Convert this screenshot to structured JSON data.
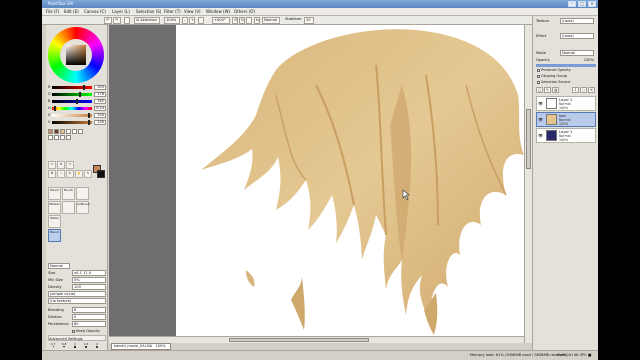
{
  "app": {
    "title": "PaintTool SAI"
  },
  "menu": [
    "File (F)",
    "Edit (E)",
    "Canvas (C)",
    "Layer (L)",
    "Selection (S)",
    "Filter (T)",
    "View (V)",
    "Window (W)",
    "Others (O)"
  ],
  "toolbar": {
    "selection_label": "Selection",
    "zoom": "100%",
    "rotation": "+000°",
    "mode": "Normal",
    "stabilizer_label": "Stabilizer",
    "stabilizer": "10"
  },
  "color_sliders": [
    {
      "label": "R",
      "value": "203"
    },
    {
      "label": "G",
      "value": "176"
    },
    {
      "label": "B",
      "value": "162"
    },
    {
      "label": "H",
      "value": "0.24"
    },
    {
      "label": "S",
      "value": "100"
    },
    {
      "label": "V",
      "value": "100"
    }
  ],
  "brushes": {
    "row1": [
      "Pencil",
      "Brush",
      ""
    ],
    "row2": [
      "Marker",
      "",
      "AirBrush"
    ],
    "row3": [
      "Water",
      "",
      ""
    ],
    "row4": [
      "Blend",
      "",
      ""
    ]
  },
  "brush_props": {
    "blend_mode": "Normal",
    "size_label": "Size",
    "size_value": "x0.1    17.0",
    "min_size_label": "Min Size",
    "min_size_value": "0%",
    "density_label": "Density",
    "density_value": "100",
    "shape_label": "(simple circle)",
    "texture_label": "(no texture)",
    "blending_label": "Blending",
    "blending_value": "8",
    "dilution_label": "Dilution",
    "dilution_value": "0",
    "persistence_label": "Persistence",
    "persistence_value": "80",
    "keep_opacity_label": "Keep Opacity",
    "advanced_label": "Advanced Settings",
    "size_dots": [
      "0.7",
      "0.8",
      "1",
      "1.5",
      "2",
      "2.3",
      "2.6",
      "3",
      "3.5",
      "4"
    ]
  },
  "right_panel": {
    "texture_label": "Texture",
    "texture_value": "(none)",
    "effect_label": "Effect",
    "effect_value": "(none)",
    "mode_label": "Mode",
    "mode_value": "Normal",
    "opacity_label": "Opacity",
    "opacity_value": "100%",
    "checks": [
      "Preserve Opacity",
      "Clipping Group",
      "Selection Source"
    ]
  },
  "layers": [
    {
      "name": "Layer 2",
      "mode": "Normal",
      "opacity": "100%",
      "selected": false,
      "thumb": "#ffffff"
    },
    {
      "name": "hair",
      "mode": "Normal",
      "opacity": "100%",
      "selected": true,
      "thumb": "#e4c58e"
    },
    {
      "name": "Layer 1",
      "mode": "Normal",
      "opacity": "100%",
      "selected": false,
      "thumb": "#28286a"
    }
  ],
  "document_tab": "kanohi_movie_SAI.SAI",
  "document_zoom": "100%",
  "status": {
    "memory": "Memory load: 61% (3456MB used / 5636MB reserved)",
    "keys": "Shift  Ctrl  Alt  SPC  ■"
  },
  "colors": {
    "hair_light": "#e2c48d",
    "hair_mid": "#d5b177",
    "hair_dark": "#bd9559",
    "primary_color": "#c7885a"
  }
}
